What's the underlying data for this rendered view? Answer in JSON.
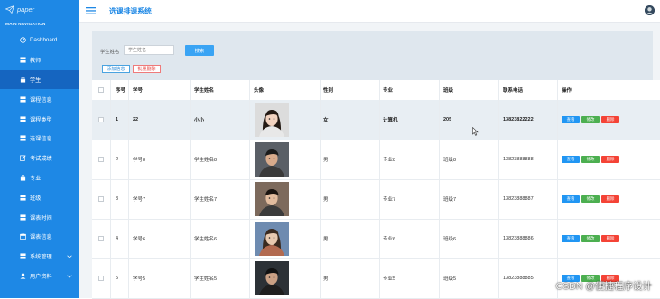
{
  "app": {
    "logo_text": "paper",
    "system_title": "选课排课系统"
  },
  "sidebar": {
    "header": "MAIN NAVIGATION",
    "items": [
      {
        "label": "Dashboard",
        "icon": "gauge-icon"
      },
      {
        "label": "教师",
        "icon": "grid-icon"
      },
      {
        "label": "学生",
        "icon": "lock-icon",
        "active": true
      },
      {
        "label": "课程信息",
        "icon": "grid-icon"
      },
      {
        "label": "课程类型",
        "icon": "grid-icon"
      },
      {
        "label": "选课信息",
        "icon": "grid-icon"
      },
      {
        "label": "考试成绩",
        "icon": "edit-icon"
      },
      {
        "label": "专业",
        "icon": "lock-icon"
      },
      {
        "label": "班级",
        "icon": "grid-icon"
      },
      {
        "label": "课表时间",
        "icon": "grid-icon"
      },
      {
        "label": "课表信息",
        "icon": "calendar-icon"
      },
      {
        "label": "系统管理",
        "icon": "grid-icon",
        "expandable": true
      },
      {
        "label": "用户资料",
        "icon": "user-icon",
        "expandable": true
      }
    ]
  },
  "search": {
    "label": "学生姓名",
    "placeholder": "学生姓名",
    "button": "搜索"
  },
  "actions": {
    "add": "添加信息",
    "batch_delete": "批量删除"
  },
  "table": {
    "headers": [
      "序号",
      "学号",
      "学生姓名",
      "头像",
      "性别",
      "专业",
      "班级",
      "联系电话",
      "操作"
    ],
    "row_buttons": {
      "view": "查看",
      "edit": "修改",
      "delete": "删除"
    },
    "rows": [
      {
        "no": "1",
        "sid": "22",
        "name": "小小",
        "gender": "女",
        "major": "计算机",
        "class": "205",
        "phone": "13823822222",
        "highlight": true
      },
      {
        "no": "2",
        "sid": "学号8",
        "name": "学生姓名8",
        "gender": "男",
        "major": "专业8",
        "class": "班级8",
        "phone": "13823888888"
      },
      {
        "no": "3",
        "sid": "学号7",
        "name": "学生姓名7",
        "gender": "男",
        "major": "专业7",
        "class": "班级7",
        "phone": "13823888887"
      },
      {
        "no": "4",
        "sid": "学号6",
        "name": "学生姓名6",
        "gender": "男",
        "major": "专业6",
        "class": "班级6",
        "phone": "13823888886"
      },
      {
        "no": "5",
        "sid": "学号5",
        "name": "学生姓名5",
        "gender": "男",
        "major": "专业5",
        "class": "班级5",
        "phone": "13823888885"
      }
    ]
  },
  "watermark": "CSDN @便捷程序设计",
  "colors": {
    "sidebar": "#1e88e5",
    "sidebar_active": "#1565c0",
    "title": "#1e88e5",
    "view": "#2196f3",
    "edit": "#4caf50",
    "delete": "#f44336"
  }
}
